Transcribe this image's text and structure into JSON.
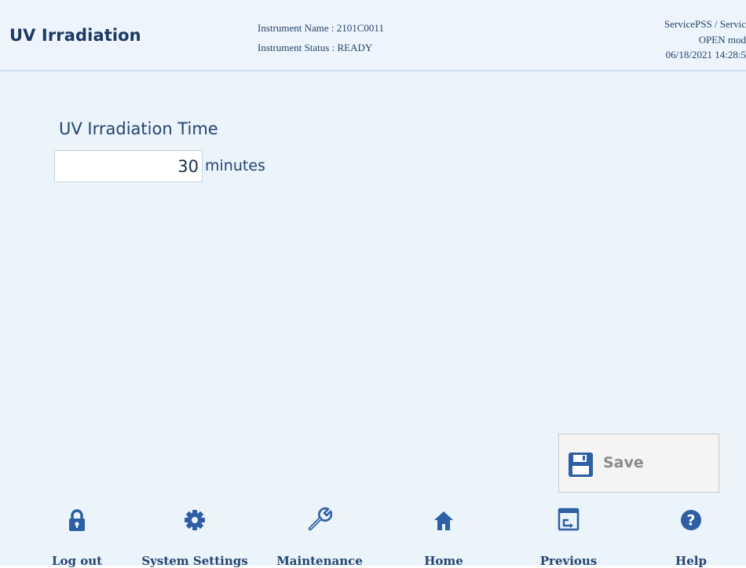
{
  "header": {
    "title": "UV Irradiation",
    "instrument_name": "Instrument Name : 2101C0011",
    "instrument_status": "Instrument Status : READY",
    "user": "ServicePSS / Servic",
    "mode": "OPEN mod",
    "datetime": "06/18/2021 14:28:5"
  },
  "form": {
    "label": "UV Irradiation Time",
    "value": "30",
    "unit": "minutes"
  },
  "actions": {
    "save_label": "Save"
  },
  "nav": [
    {
      "label": "Log out",
      "icon": "lock-icon"
    },
    {
      "label": "System Settings",
      "icon": "gear-icon"
    },
    {
      "label": "Maintenance",
      "icon": "wrench-icon"
    },
    {
      "label": "Home",
      "icon": "home-icon"
    },
    {
      "label": "Previous",
      "icon": "previous-window-icon"
    },
    {
      "label": "Help",
      "icon": "help-icon"
    }
  ],
  "colors": {
    "primary_text": "#1b3a63",
    "background": "#ebf3fb",
    "icon_blue": "#2d5fa4",
    "disabled_text": "#8a8a8a"
  }
}
